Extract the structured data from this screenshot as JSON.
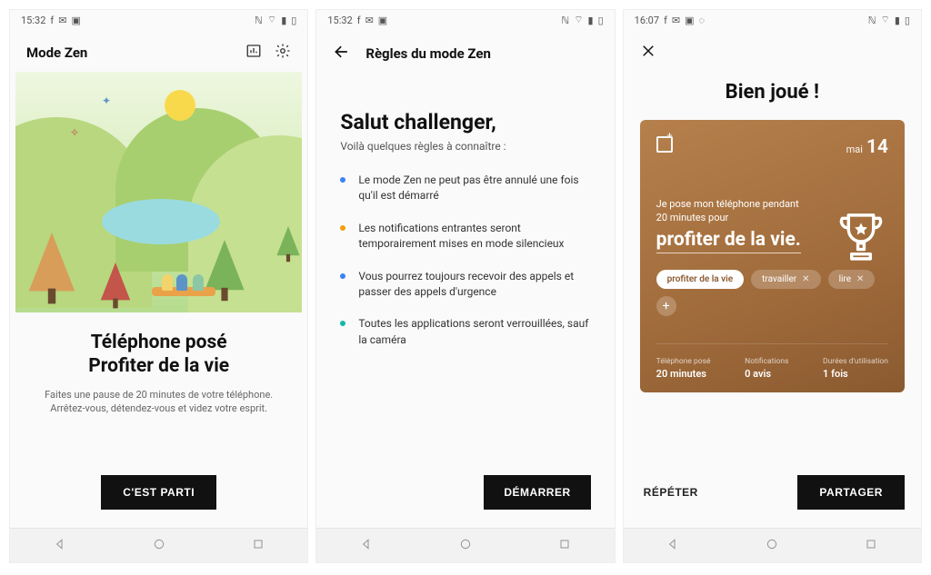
{
  "status": {
    "time1": "15:32",
    "time2": "15:32",
    "time3": "16:07"
  },
  "screen1": {
    "title": "Mode Zen",
    "heading_line1": "Téléphone posé",
    "heading_line2": "Profiter de la vie",
    "sub": "Faites une pause de 20 minutes de votre téléphone. Arrêtez-vous, détendez-vous et videz votre esprit.",
    "cta": "C'EST PARTI"
  },
  "screen2": {
    "back_title": "Règles du mode Zen",
    "heading": "Salut challenger,",
    "sub": "Voilà quelques règles à connaître :",
    "rules": [
      "Le mode Zen ne peut pas être annulé une fois qu'il est démarré",
      "Les notifications entrantes seront temporairement mises en mode silencieux",
      "Vous pourrez toujours recevoir des appels et passer des appels d'urgence",
      "Toutes les applications seront verrouillées, sauf la caméra"
    ],
    "cta": "DÉMARRER"
  },
  "screen3": {
    "heading": "Bien joué !",
    "month": "mai",
    "day": "14",
    "lead": "Je pose mon téléphone pendant 20 minutes pour",
    "phrase": "profiter de la vie.",
    "chips": {
      "c1": "profiter de la vie",
      "c2": "travailler",
      "c3": "lire"
    },
    "stats": {
      "l1": "Téléphone posé",
      "v1": "20 minutes",
      "l2": "Notifications",
      "v2": "0 avis",
      "l3": "Durées d'utilisation",
      "v3": "1 fois"
    },
    "repeat": "RÉPÉTER",
    "share": "PARTAGER"
  }
}
